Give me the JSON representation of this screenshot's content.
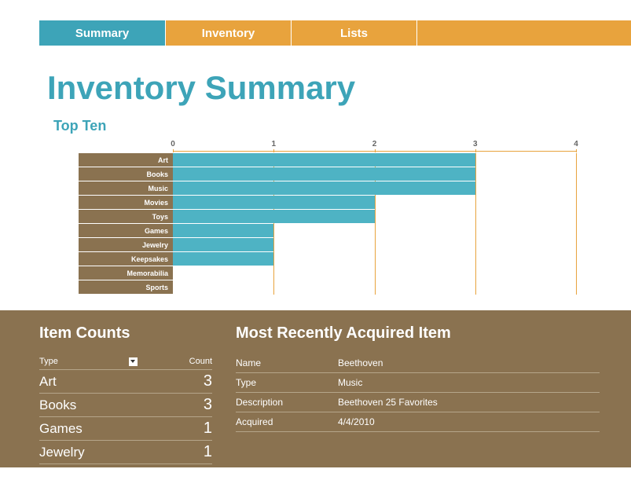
{
  "tabs": [
    {
      "label": "Summary",
      "active": true
    },
    {
      "label": "Inventory",
      "active": false
    },
    {
      "label": "Lists",
      "active": false
    }
  ],
  "page_title": "Inventory Summary",
  "chart_section_title": "Top Ten",
  "chart_data": {
    "type": "bar",
    "categories": [
      "Art",
      "Books",
      "Music",
      "Movies",
      "Toys",
      "Games",
      "Jewelry",
      "Keepsakes",
      "Memorabilia",
      "Sports"
    ],
    "values": [
      3,
      3,
      3,
      2,
      2,
      1,
      1,
      1,
      0,
      0
    ],
    "title": "Top Ten",
    "xlabel": "",
    "ylabel": "",
    "xlim": [
      0,
      4
    ],
    "ticks": [
      0,
      1,
      2,
      3,
      4
    ]
  },
  "item_counts": {
    "title": "Item Counts",
    "header_type": "Type",
    "header_count": "Count",
    "rows": [
      {
        "type": "Art",
        "count": "3"
      },
      {
        "type": "Books",
        "count": "3"
      },
      {
        "type": "Games",
        "count": "1"
      },
      {
        "type": "Jewelry",
        "count": "1"
      }
    ]
  },
  "recent": {
    "title": "Most Recently Acquired Item",
    "rows": [
      {
        "label": "Name",
        "value": "Beethoven"
      },
      {
        "label": "Type",
        "value": "Music"
      },
      {
        "label": "Description",
        "value": "Beethoven 25 Favorites"
      },
      {
        "label": "Acquired",
        "value": "4/4/2010"
      }
    ]
  }
}
